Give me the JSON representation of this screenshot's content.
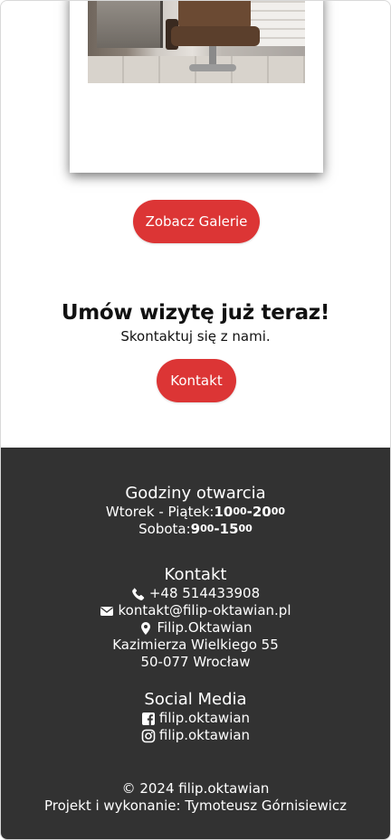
{
  "gallery": {
    "button_label": "Zobacz Galerie"
  },
  "cta": {
    "title": "Umów wizytę już teraz!",
    "subtitle": "Skontaktuj się z nami.",
    "button_label": "Kontakt"
  },
  "footer": {
    "hours": {
      "heading": "Godziny otwarcia",
      "weekday_label": "Wtorek - Piątek: ",
      "weekday_open_h": "10",
      "weekday_open_m": "00",
      "weekday_sep": "-",
      "weekday_close_h": "20",
      "weekday_close_m": "00",
      "saturday_label": "Sobota: ",
      "saturday_open_h": "9",
      "saturday_open_m": "00",
      "saturday_sep": "-",
      "saturday_close_h": "15",
      "saturday_close_m": "00"
    },
    "contact": {
      "heading": "Kontakt",
      "phone": "+48 514433908",
      "email": "kontakt@filip-oktawian.pl",
      "place_name": "Filip.Oktawian",
      "street": "Kazimierza Wielkiego 55",
      "city": "50-077 Wrocław",
      "icons": [
        "phone-icon",
        "envelope-icon",
        "map-marker-icon"
      ]
    },
    "social": {
      "heading": "Social Media",
      "facebook": "filip.oktawian",
      "instagram": "filip.oktawian",
      "icons": [
        "facebook-icon",
        "instagram-icon"
      ]
    },
    "copyright": "© 2024 filip.oktawian",
    "credits": "Projekt i wykonanie: Tymoteusz Górnisiewicz"
  },
  "colors": {
    "accent": "#dc3535",
    "footer_bg": "#323232",
    "footer_text": "#ffffff"
  }
}
